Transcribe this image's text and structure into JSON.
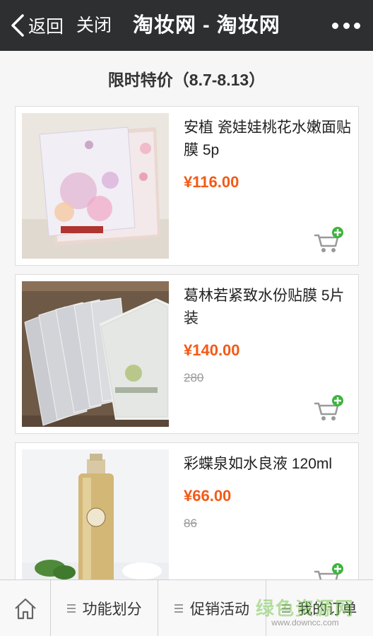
{
  "topbar": {
    "back_label": "返回",
    "close_label": "关闭",
    "title": "淘妆网 - 淘妆网"
  },
  "section": {
    "title": "限时特价（8.7-8.13）"
  },
  "products": [
    {
      "name": "安植 瓷娃娃桃花水嫩面贴膜 5p",
      "price": "¥116.00",
      "original_price": ""
    },
    {
      "name": "葛林若紧致水份贴膜 5片装",
      "price": "¥140.00",
      "original_price": "280"
    },
    {
      "name": "彩蝶泉如水良液 120ml",
      "price": "¥66.00",
      "original_price": "86"
    }
  ],
  "bottom_nav": [
    {
      "label": "",
      "icon": "home-icon"
    },
    {
      "label": "功能划分",
      "icon": "menu-icon"
    },
    {
      "label": "促销活动",
      "icon": "menu-icon"
    },
    {
      "label": "我的订单",
      "icon": "menu-icon"
    }
  ],
  "watermark": {
    "main": "绿色资源网",
    "sub": "www.downcc.com"
  },
  "colors": {
    "topbar": "#2e2f31",
    "price": "#f25a17",
    "cart_badge": "#3cb43c"
  }
}
